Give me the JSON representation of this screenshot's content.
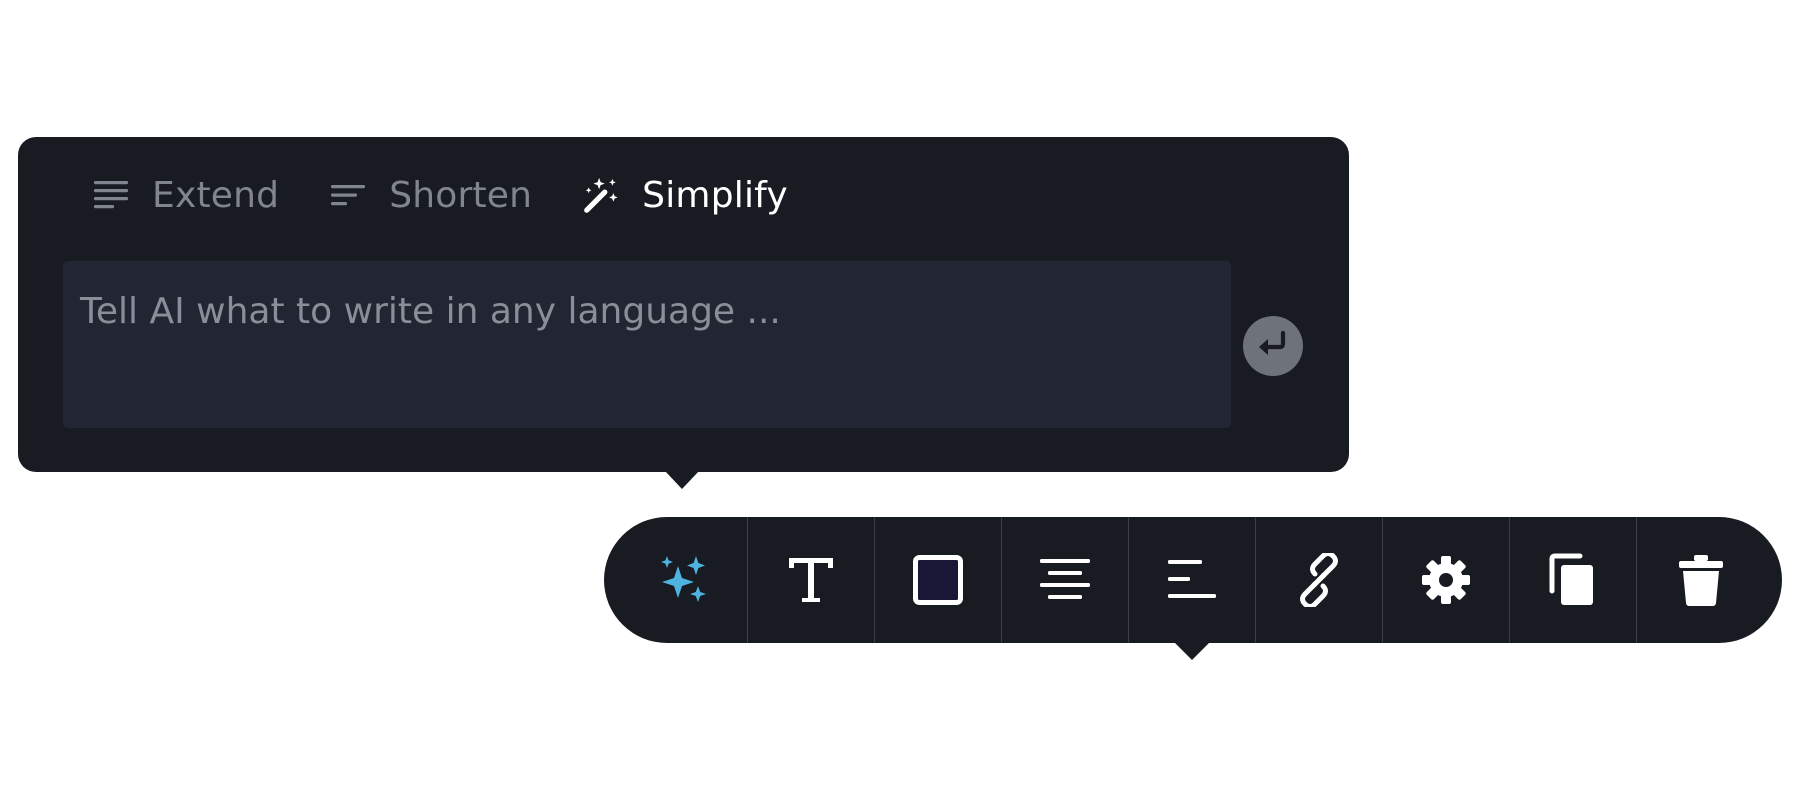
{
  "ai_panel": {
    "actions": [
      {
        "label": "Extend",
        "icon": "lines-icon",
        "active": false
      },
      {
        "label": "Shorten",
        "icon": "short-lines-icon",
        "active": false
      },
      {
        "label": "Simplify",
        "icon": "magic-wand-icon",
        "active": true
      }
    ],
    "prompt": {
      "value": "",
      "placeholder": "Tell AI what to write in any language ..."
    },
    "send_icon": "enter-return-icon"
  },
  "toolbar": {
    "tools": [
      {
        "name": "ai-sparkle",
        "icon": "sparkles-icon",
        "color": "#4fb3e0"
      },
      {
        "name": "text",
        "icon": "text-type-icon"
      },
      {
        "name": "color",
        "icon": "color-swatch-icon",
        "swatch_color": "#1a1636"
      },
      {
        "name": "align-center",
        "icon": "align-center-icon"
      },
      {
        "name": "align-left",
        "icon": "align-left-icon"
      },
      {
        "name": "link",
        "icon": "link-icon"
      },
      {
        "name": "settings",
        "icon": "gear-icon"
      },
      {
        "name": "duplicate",
        "icon": "copy-icon"
      },
      {
        "name": "delete",
        "icon": "trash-icon"
      }
    ]
  },
  "colors": {
    "panel_bg": "#181b22",
    "input_bg": "#222632",
    "muted_text": "#80858f",
    "active_text": "#ffffff",
    "accent": "#4fb3e0",
    "send_button_bg": "#6e727a"
  }
}
